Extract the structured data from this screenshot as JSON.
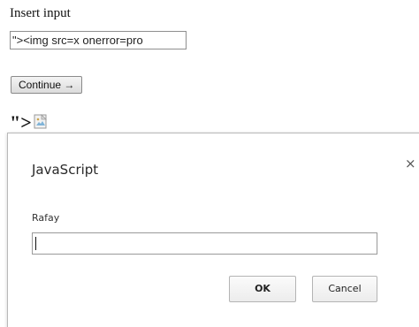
{
  "form": {
    "heading": "Insert input",
    "input_value": "\"><img src=x onerror=pro",
    "continue_label": "Continue →"
  },
  "output": {
    "echo_text": "\">",
    "image_icon": "broken-image-icon"
  },
  "dialog": {
    "title": "JavaScript",
    "close_icon": "close-icon",
    "close_glyph": "×",
    "message": "Rafay",
    "input_value": "",
    "ok_label": "OK",
    "cancel_label": "Cancel"
  }
}
